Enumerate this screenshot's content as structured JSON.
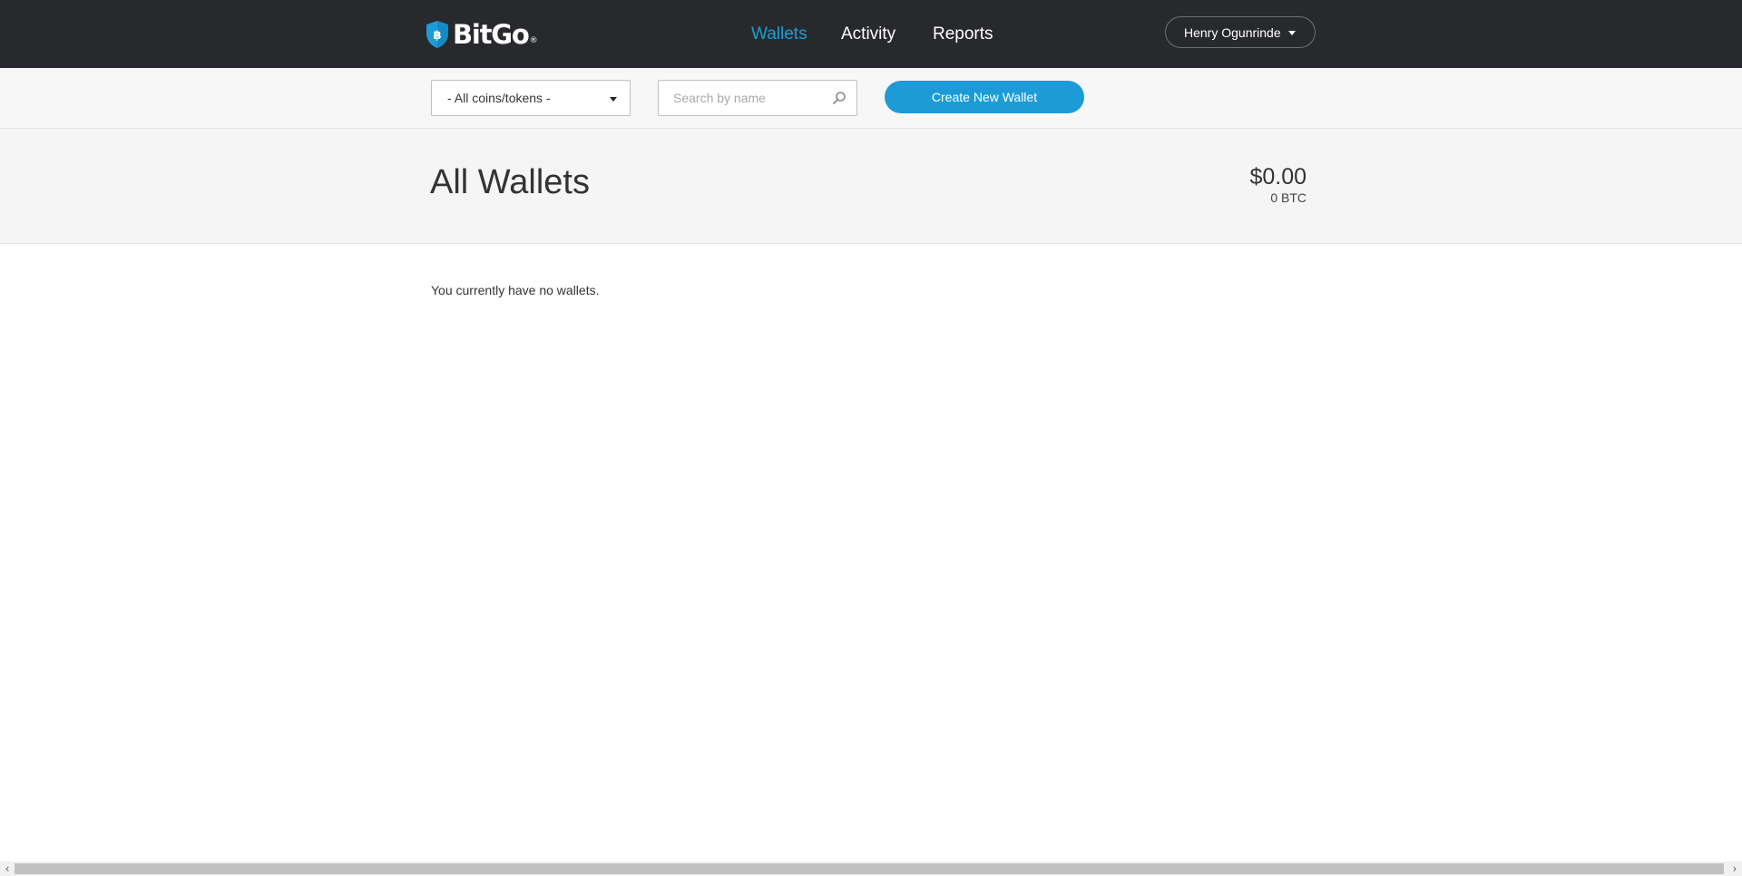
{
  "header": {
    "brand": "BitGo",
    "brand_mark": "®",
    "nav": [
      {
        "label": "Wallets",
        "active": true
      },
      {
        "label": "Activity",
        "active": false
      },
      {
        "label": "Reports",
        "active": false
      }
    ],
    "user_name": "Henry Ogunrinde"
  },
  "toolbar": {
    "coin_filter_value": "- All coins/tokens -",
    "search_placeholder": "Search by name",
    "create_button_label": "Create New Wallet"
  },
  "page": {
    "title": "All Wallets",
    "balance_usd": "$0.00",
    "balance_btc": "0 BTC",
    "empty_message": "You currently have no wallets."
  },
  "icons": {
    "logo": "bitgo-shield-icon",
    "user_caret": "caret-down-icon",
    "select_caret": "caret-down-icon",
    "search": "search-icon",
    "scroll_left": "chevron-left-icon",
    "scroll_right": "chevron-right-icon"
  },
  "colors": {
    "topbar_bg": "#28292c",
    "accent": "#1c9bd7",
    "active_nav": "#1a9ed9",
    "toolbar_bg": "#f7f7f7",
    "header_band_bg": "#f5f5f5"
  }
}
